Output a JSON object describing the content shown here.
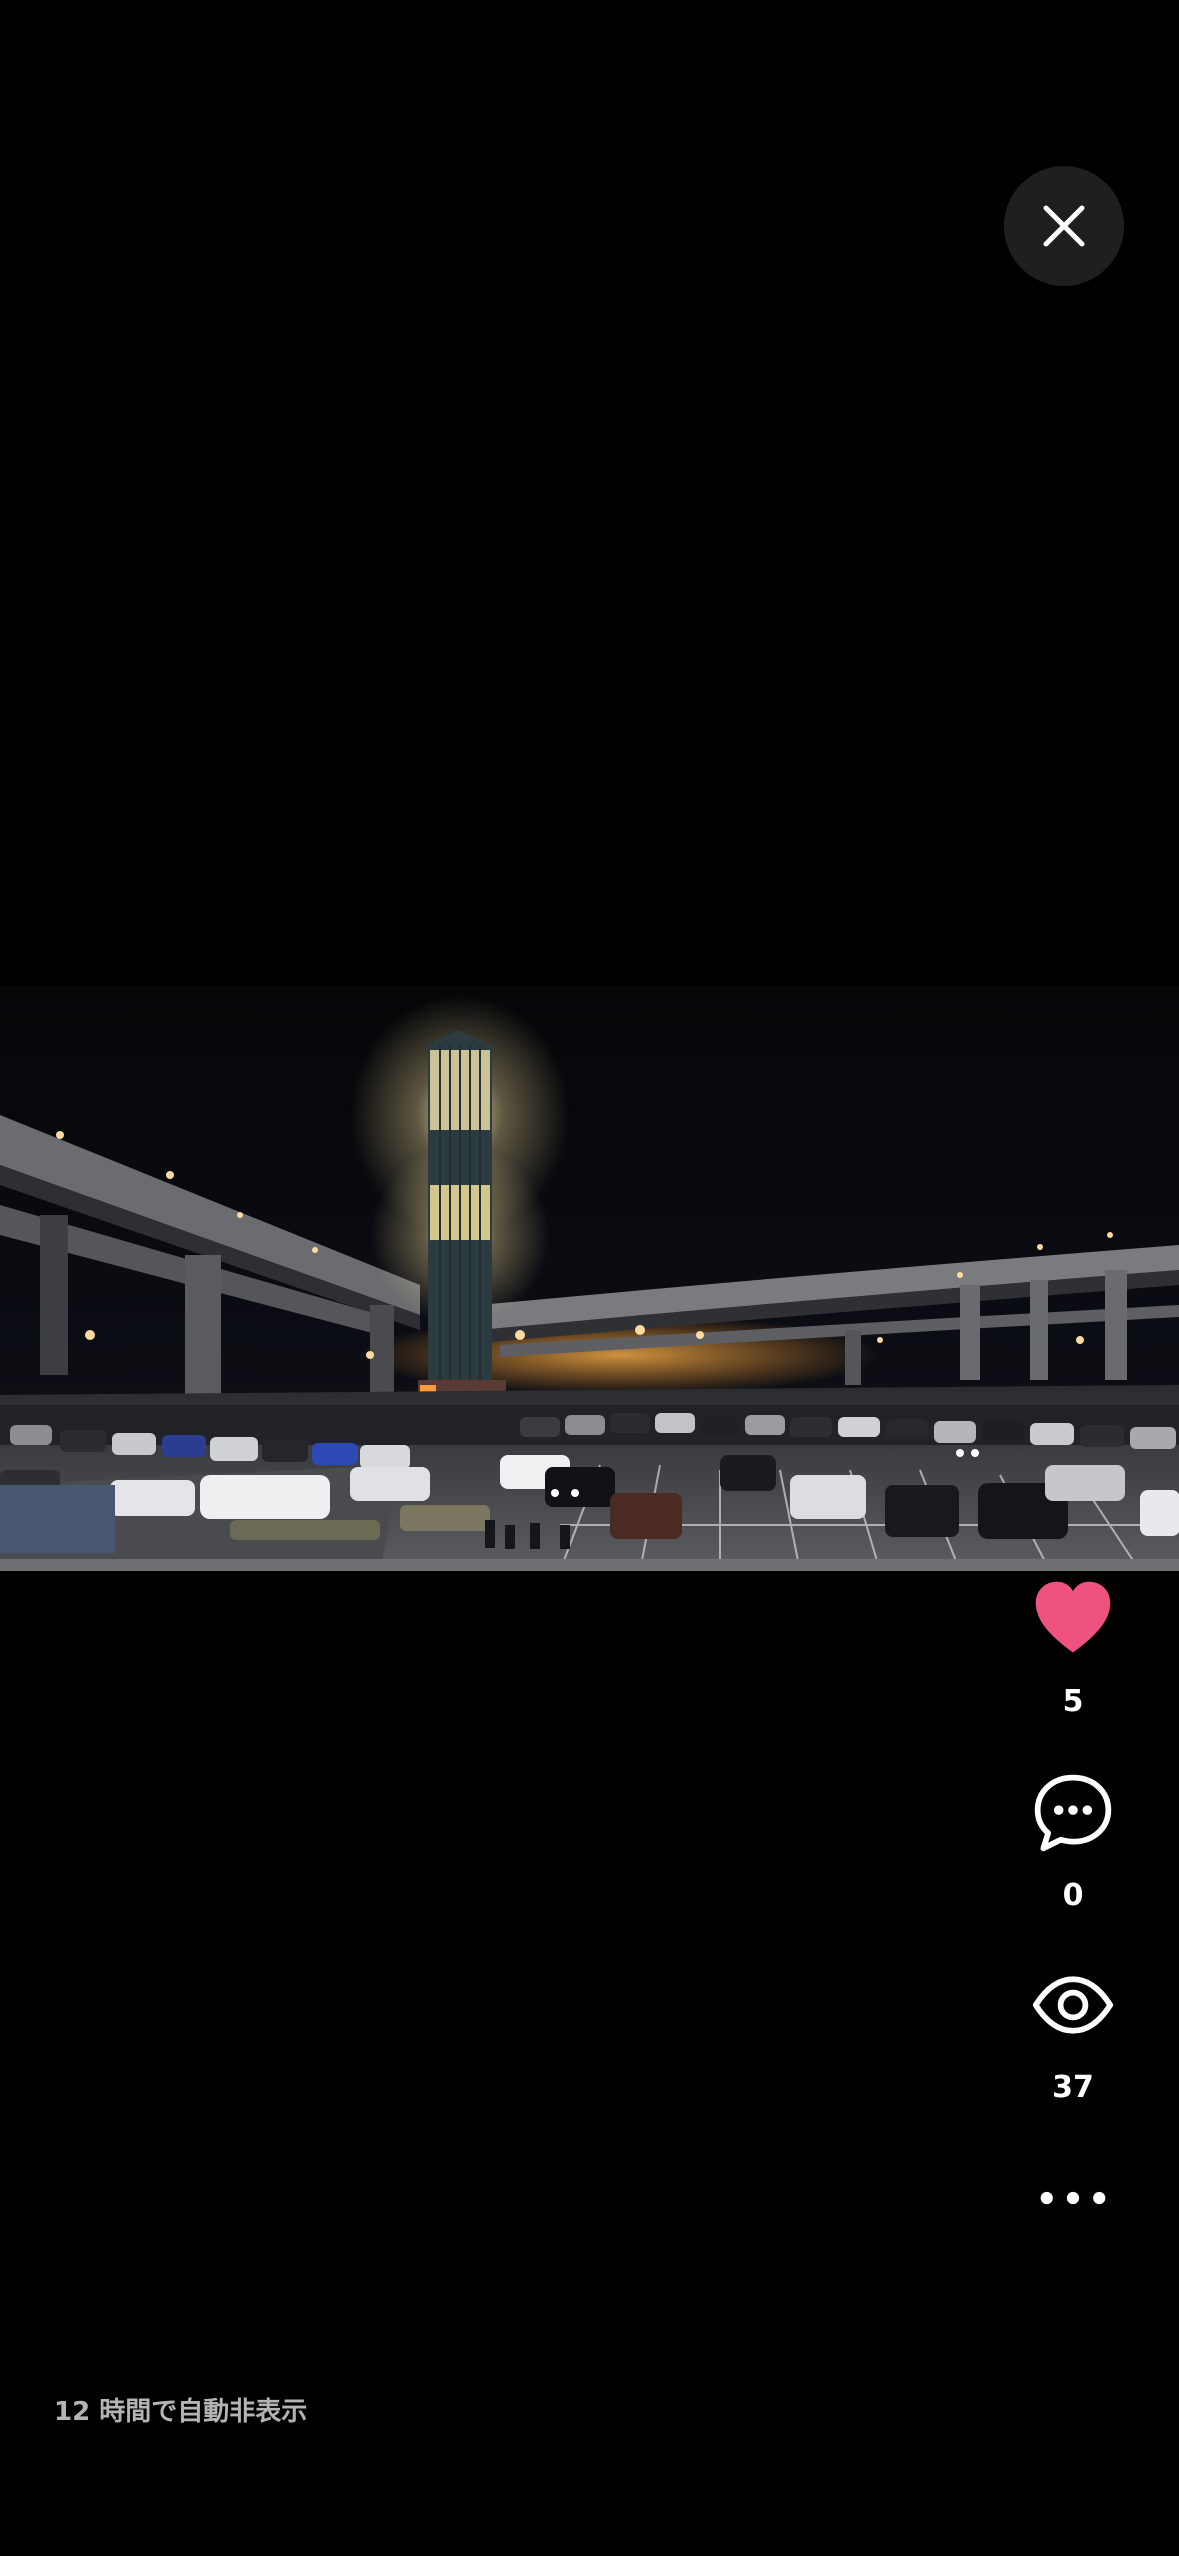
{
  "close_button": {
    "icon": "close-icon"
  },
  "photo": {
    "description_icon": "photo-night-parking"
  },
  "actions": {
    "like": {
      "icon": "heart-icon",
      "count": "5",
      "color": "#f0527f"
    },
    "comment": {
      "icon": "comment-bubble-icon",
      "count": "0"
    },
    "views": {
      "icon": "eye-icon",
      "count": "37"
    },
    "more": {
      "icon": "more-dots-icon"
    }
  },
  "footer": {
    "auto_hide_text": "12 時間で自動非表示"
  }
}
